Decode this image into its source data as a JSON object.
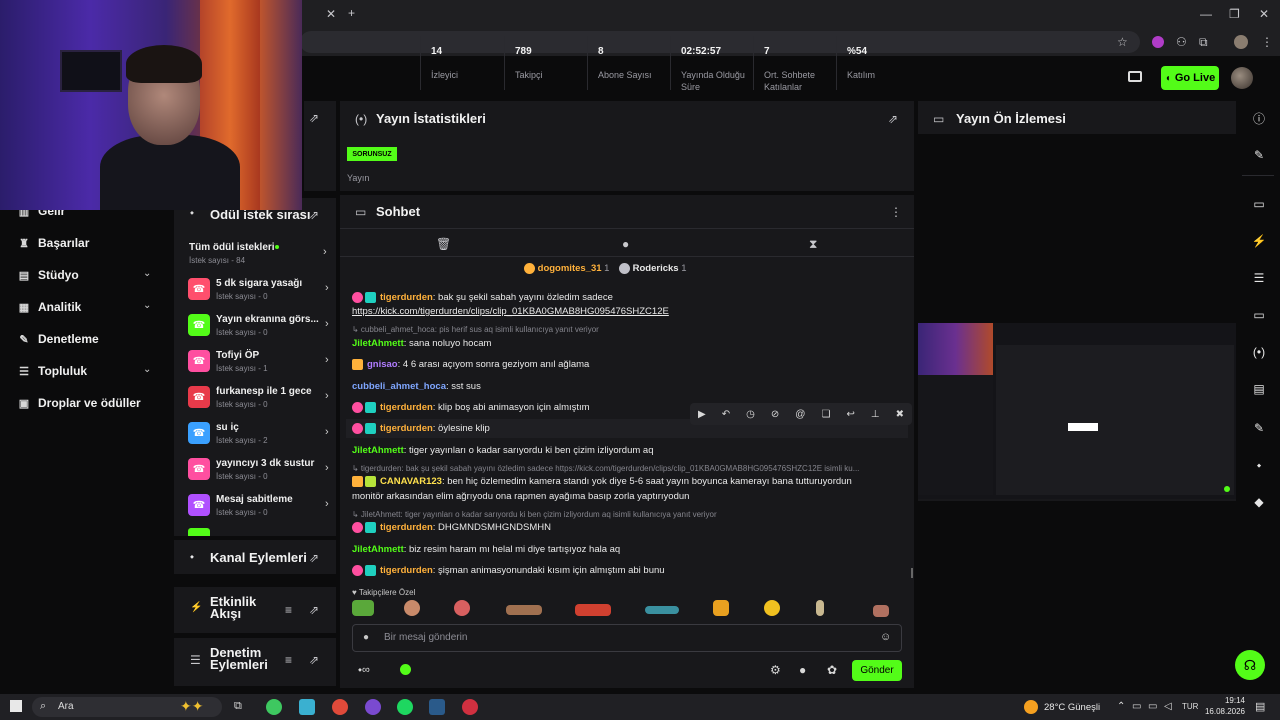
{
  "browser": {
    "new_tab": "+",
    "window_controls": [
      "—",
      "❐",
      "✕"
    ]
  },
  "header": {
    "go_live": "Go Live"
  },
  "left_nav": {
    "items": [
      {
        "label": "Gelir",
        "icon": "chart-icon",
        "has_chevron": false
      },
      {
        "label": "Başarılar",
        "icon": "trophy-icon",
        "has_chevron": false
      },
      {
        "label": "Stüdyo",
        "icon": "studio-icon",
        "has_chevron": true
      },
      {
        "label": "Analitik",
        "icon": "analytics-icon",
        "has_chevron": true
      },
      {
        "label": "Denetleme",
        "icon": "wrench-icon",
        "has_chevron": false
      },
      {
        "label": "Topluluk",
        "icon": "community-icon",
        "has_chevron": true
      },
      {
        "label": "Droplar ve ödüller",
        "icon": "gift-icon",
        "has_chevron": false
      }
    ]
  },
  "rewards": {
    "title": "Ödül istek sırası",
    "all": {
      "title": "Tüm ödül istekleri",
      "sub": "İstek sayısı - 84"
    },
    "items": [
      {
        "title": "5 dk sigara yasağı",
        "sub": "İstek sayısı - 0",
        "color": "#ff4f6d"
      },
      {
        "title": "Yayın ekranına görs...",
        "sub": "İstek sayısı - 0",
        "color": "#53fc18"
      },
      {
        "title": "Tofiyi ÖP",
        "sub": "İstek sayısı - 1",
        "color": "#ff4fa0"
      },
      {
        "title": "furkanesp ile 1 gece",
        "sub": "İstek sayısı - 0",
        "color": "#e83a4a"
      },
      {
        "title": "su iç",
        "sub": "İstek sayısı - 2",
        "color": "#3aa0ff"
      },
      {
        "title": "yayıncıyı 3 dk sustur",
        "sub": "İstek sayısı - 0",
        "color": "#ff4fa0"
      },
      {
        "title": "Mesaj sabitleme",
        "sub": "İstek sayısı - 0",
        "color": "#b050ff"
      }
    ]
  },
  "side_panels": {
    "channel_actions": "Kanal Eylemleri",
    "activity_feed": "Etkinlik Akışı",
    "moderation_actions": "Denetim Eylemleri"
  },
  "stats": {
    "title": "Yayın İstatistikleri",
    "status_badge": "SORUNSUZ",
    "status_label": "Yayın",
    "items": [
      {
        "value": "14",
        "label": "İzleyici"
      },
      {
        "value": "789",
        "label": "Takipçi"
      },
      {
        "value": "8",
        "label": "Abone Sayısı"
      },
      {
        "value": "02:52:57",
        "label": "Yayında Olduğu Süre"
      },
      {
        "value": "7",
        "label": "Ort. Sohbete Katılanlar"
      },
      {
        "value": "%54",
        "label": "Katılım"
      }
    ]
  },
  "chat": {
    "title": "Sohbet",
    "top_gifters": [
      {
        "name": "dogomites_31",
        "count": "1"
      },
      {
        "name": "Rodericks",
        "count": "1"
      }
    ],
    "messages": [
      {
        "user": "tigerdurden",
        "text": ": bak şu şekil sabah yayını özledim sadece"
      },
      {
        "link": "https://kick.com/tigerdurden/clips/clip_01KBA0GMAB8HG095476SHZC12E"
      },
      {
        "reply": "↳ cubbeli_ahmet_hoca: pis herif sus aq isimli kullanıcıya yanıt veriyor"
      },
      {
        "user": "JiletAhmett",
        "text": ": sana noluyo hocam"
      },
      {
        "user": "gnisao",
        "text": ": 4 6 arası açıyom sonra geziyom anıl ağlama"
      },
      {
        "user": "cubbeli_ahmet_hoca",
        "text": ": sst sus"
      },
      {
        "user": "tigerdurden",
        "text": ": klip boş abi animasyon için almıştım"
      },
      {
        "user": "tigerdurden",
        "text": ": öylesine klip"
      },
      {
        "user": "JiletAhmett",
        "text": ": tiger yayınları o kadar sarıyordu ki ben çizim izliyordum aq"
      },
      {
        "reply": "↳ tigerdurden: bak şu şekil sabah yayını özledim sadece https://kick.com/tigerdurden/clips/clip_01KBA0GMAB8HG095476SHZC12E isimli ku..."
      },
      {
        "user": "CANAVAR123",
        "text": ": ben hiç özlemedim kamera standı yok diye 5-6 saat yayın boyunca kamerayı bana tutturuyordun"
      },
      {
        "text": "monitör arkasından elim ağrıyodu ona rapmen ayağıma basıp zorla yaptırıyodun"
      },
      {
        "reply": "↳ JiletAhmett: tiger yayınları o kadar sarıyordu ki ben çizim izliyordum aq isimli kullanıcıya yanıt veriyor"
      },
      {
        "user": "tigerdurden",
        "text": ": DHGMNDSMHGNDSMHN"
      },
      {
        "user": "JiletAhmett",
        "text": ": biz resim haram mı helal mi diye tartışıyoz hala aq"
      },
      {
        "user": "tigerdurden",
        "text": ": şişman animasyonundaki kısım için almıştım abi bunu"
      }
    ],
    "followers_only": "Takipçilere Özel",
    "input_placeholder": "Bir mesaj gönderin",
    "send": "Gönder"
  },
  "preview": {
    "title": "Yayın Ön İzlemesi"
  },
  "taskbar": {
    "search": "Ara",
    "weather": "28°C Güneşli",
    "lang": "TUR",
    "time": "19:14",
    "date": "16.08.2026"
  }
}
